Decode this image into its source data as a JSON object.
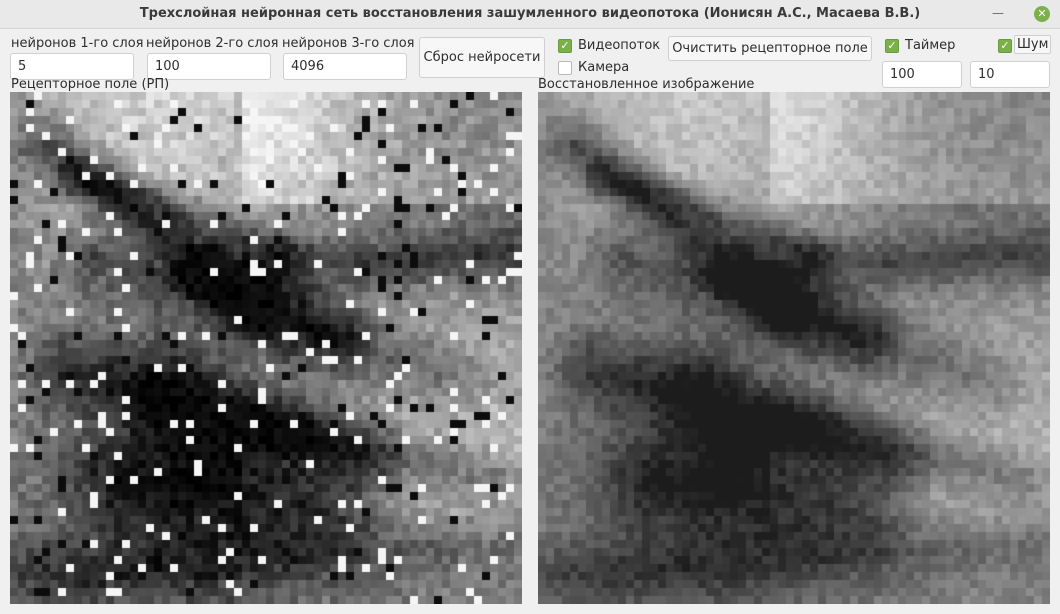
{
  "window": {
    "title": "Трехслойная нейронная сеть восстановления зашумленного видеопотока (Ионисян А.С., Масаева В.В.)"
  },
  "layer1": {
    "label": "нейронов 1-го слоя",
    "value": "5"
  },
  "layer2": {
    "label": "нейронов 2-го слоя",
    "value": "100"
  },
  "layer3": {
    "label": "нейронов 3-го слоя",
    "value": "4096"
  },
  "buttons": {
    "reset": "Сброс нейросети",
    "clear": "Очистить рецепторное поле"
  },
  "video": {
    "label": "Видеопоток",
    "checked": true
  },
  "camera": {
    "label": "Камера",
    "checked": false
  },
  "timer": {
    "label": "Таймер",
    "checked": true,
    "value": "100"
  },
  "noise": {
    "label": "Шум",
    "checked": true,
    "value": "10"
  },
  "panels": {
    "receptive_label": "Рецепторное поле (РП)",
    "restored_label": "Восстановленное изображение"
  },
  "colors": {
    "accent": "#7bb04a"
  }
}
